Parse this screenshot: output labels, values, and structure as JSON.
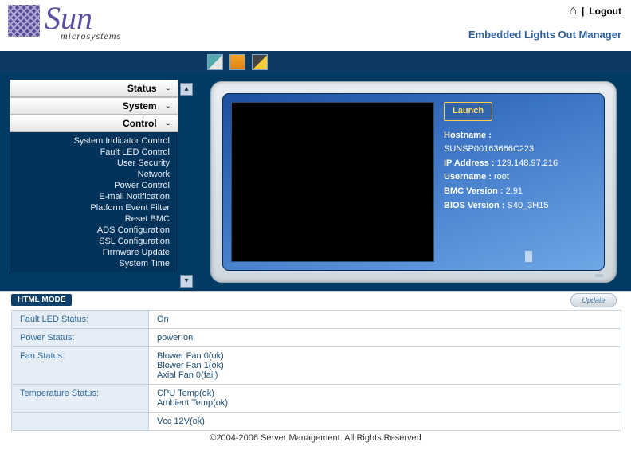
{
  "header": {
    "brand_main": "Sun",
    "brand_sub": "microsystems",
    "logout": "Logout",
    "divider": "|",
    "product_title": "Embedded Lights Out Manager"
  },
  "toolbar": {
    "icons": [
      "tool-monitor",
      "tool-orange",
      "tool-contrast"
    ]
  },
  "sidebar": {
    "sections": {
      "status": "Status",
      "system": "System",
      "control": "Control"
    },
    "control_items": [
      "System Indicator Control",
      "Fault LED Control",
      "User Security",
      "Network",
      "Power Control",
      "E-mail Notification",
      "Platform Event Filter",
      "Reset BMC",
      "ADS Configuration",
      "SSL Configuration",
      "Firmware Update",
      "System Time"
    ]
  },
  "console": {
    "launch": "Launch",
    "hostname_label": "Hostname :",
    "hostname_value": "SUNSP00163666C223",
    "ip_label": "IP Address :",
    "ip_value": "129.148.97.216",
    "username_label": "Username :",
    "username_value": "root",
    "bmc_label": "BMC Version :",
    "bmc_value": "2.91",
    "bios_label": "BIOS Version :",
    "bios_value": "S40_3H15"
  },
  "mode_row": {
    "mode_tab": "HTML MODE",
    "update": "Update"
  },
  "status_rows": [
    {
      "label": "Fault LED Status:",
      "values": [
        "On"
      ]
    },
    {
      "label": "Power Status:",
      "values": [
        "power on"
      ]
    },
    {
      "label": "Fan Status:",
      "values": [
        "Blower Fan 0(ok)",
        "Blower Fan 1(ok)",
        "Axial Fan 0(fail)"
      ]
    },
    {
      "label": "Temperature Status:",
      "values": [
        "CPU Temp(ok)",
        "Ambient Temp(ok)"
      ]
    },
    {
      "label": "",
      "values": [
        "Vcc 12V(ok)"
      ]
    }
  ],
  "footer": "©2004-2006 Server Management.   All Rights Reserved"
}
